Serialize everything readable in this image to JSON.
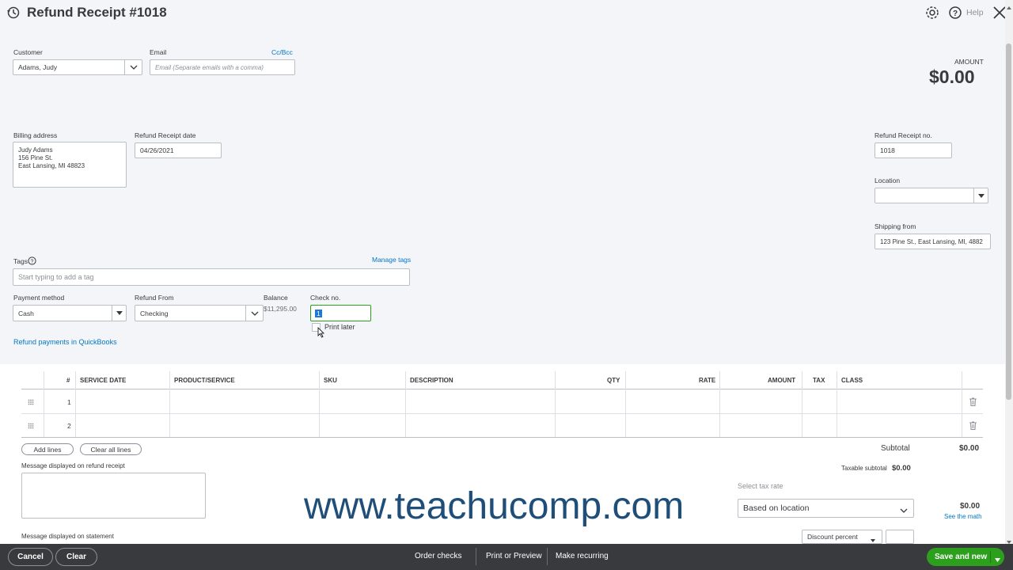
{
  "header": {
    "title": "Refund Receipt #1018",
    "help_label": "Help"
  },
  "customer": {
    "label": "Customer",
    "value": "Adams, Judy"
  },
  "email": {
    "label": "Email",
    "placeholder": "Email (Separate emails with a comma)",
    "ccbcc": "Cc/Bcc"
  },
  "amount": {
    "label": "AMOUNT",
    "value": "$0.00"
  },
  "billing": {
    "label": "Billing address",
    "line1": "Judy Adams",
    "line2": "156 Pine St.",
    "line3": "East Lansing, MI  48823"
  },
  "receipt_date": {
    "label": "Refund Receipt date",
    "value": "04/26/2021"
  },
  "receipt_no": {
    "label": "Refund Receipt no.",
    "value": "1018"
  },
  "location": {
    "label": "Location",
    "value": ""
  },
  "shipping_from": {
    "label": "Shipping from",
    "value": "123 Pine St., East Lansing, MI, 4882"
  },
  "tags": {
    "label": "Tags",
    "manage": "Manage tags",
    "placeholder": "Start typing to add a tag"
  },
  "payment_method": {
    "label": "Payment method",
    "value": "Cash"
  },
  "refund_from": {
    "label": "Refund From",
    "value": "Checking"
  },
  "balance": {
    "label": "Balance",
    "value": "$11,295.00"
  },
  "check_no": {
    "label": "Check no.",
    "value": "1",
    "print_later": "Print later"
  },
  "refund_link": "Refund payments in QuickBooks",
  "table": {
    "columns": [
      "#",
      "SERVICE DATE",
      "PRODUCT/SERVICE",
      "SKU",
      "DESCRIPTION",
      "QTY",
      "RATE",
      "AMOUNT",
      "TAX",
      "CLASS"
    ],
    "rows": [
      {
        "num": "1"
      },
      {
        "num": "2"
      }
    ]
  },
  "actions": {
    "add_lines": "Add lines",
    "clear_lines": "Clear all lines"
  },
  "totals": {
    "subtotal_label": "Subtotal",
    "subtotal_value": "$0.00",
    "taxable_label": "Taxable subtotal",
    "taxable_value": "$0.00",
    "tax_rate_label": "Select tax rate",
    "tax_rate_value": "Based on location",
    "tax_value": "$0.00",
    "see_math": "See the math",
    "discount_select": "Discount percent",
    "discount_value": ""
  },
  "messages": {
    "receipt_label": "Message displayed on refund receipt",
    "statement_label": "Message displayed on statement"
  },
  "watermark": "www.teachucomp.com",
  "footer": {
    "cancel": "Cancel",
    "clear": "Clear",
    "order_checks": "Order checks",
    "print_preview": "Print or Preview",
    "make_recurring": "Make recurring",
    "save_new": "Save and new"
  },
  "colors": {
    "green": "#2ca01c",
    "link": "#0077c5",
    "footer": "#393a3d",
    "watermark": "#1f4e79"
  }
}
